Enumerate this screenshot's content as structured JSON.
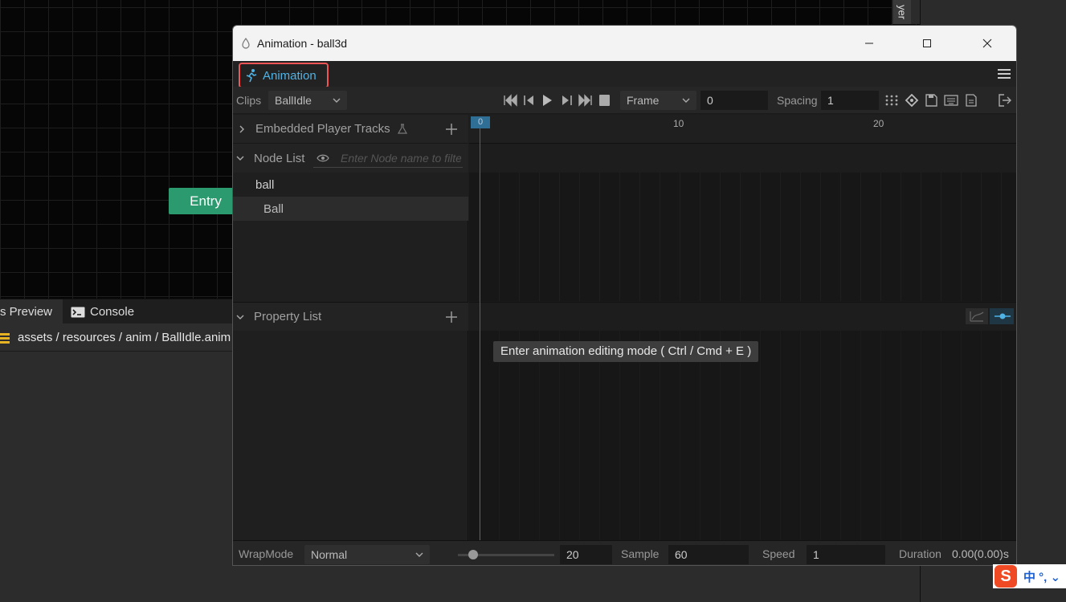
{
  "background": {
    "entry_node_label": "Entry",
    "side_tab_label": "yer"
  },
  "bottom_panel": {
    "tab_preview": "s Preview",
    "tab_console": "Console",
    "asset_path": "assets / resources / anim / BallIdle.anim"
  },
  "window": {
    "title": "Animation - ball3d",
    "panel_tab": "Animation"
  },
  "toolbar": {
    "clips_label": "Clips",
    "clip_value": "BallIdle",
    "frame_mode": "Frame",
    "frame_value": "0",
    "spacing_label": "Spacing",
    "spacing_value": "1"
  },
  "left_pane": {
    "embedded_tracks": "Embedded Player Tracks",
    "node_list": "Node List",
    "node_filter_placeholder": "Enter Node name to filter",
    "nodes": [
      "ball",
      "Ball"
    ],
    "property_list": "Property List"
  },
  "timeline": {
    "ticks": [
      "0",
      "10",
      "20"
    ],
    "tooltip": "Enter animation editing mode ( Ctrl / Cmd + E )"
  },
  "statusbar": {
    "wrapmode_label": "WrapMode",
    "wrapmode_value": "Normal",
    "slider_value": "20",
    "sample_label": "Sample",
    "sample_value": "60",
    "speed_label": "Speed",
    "speed_value": "1",
    "duration_label": "Duration",
    "duration_value": "0.00(0.00)s"
  },
  "ime": {
    "logo": "S",
    "text": "中 °, ⌄"
  },
  "colors": {
    "accent_blue": "#4fb3e6",
    "highlight_red": "#f05454",
    "entry_green": "#2b9a6e",
    "playhead": "#2f6f96"
  }
}
